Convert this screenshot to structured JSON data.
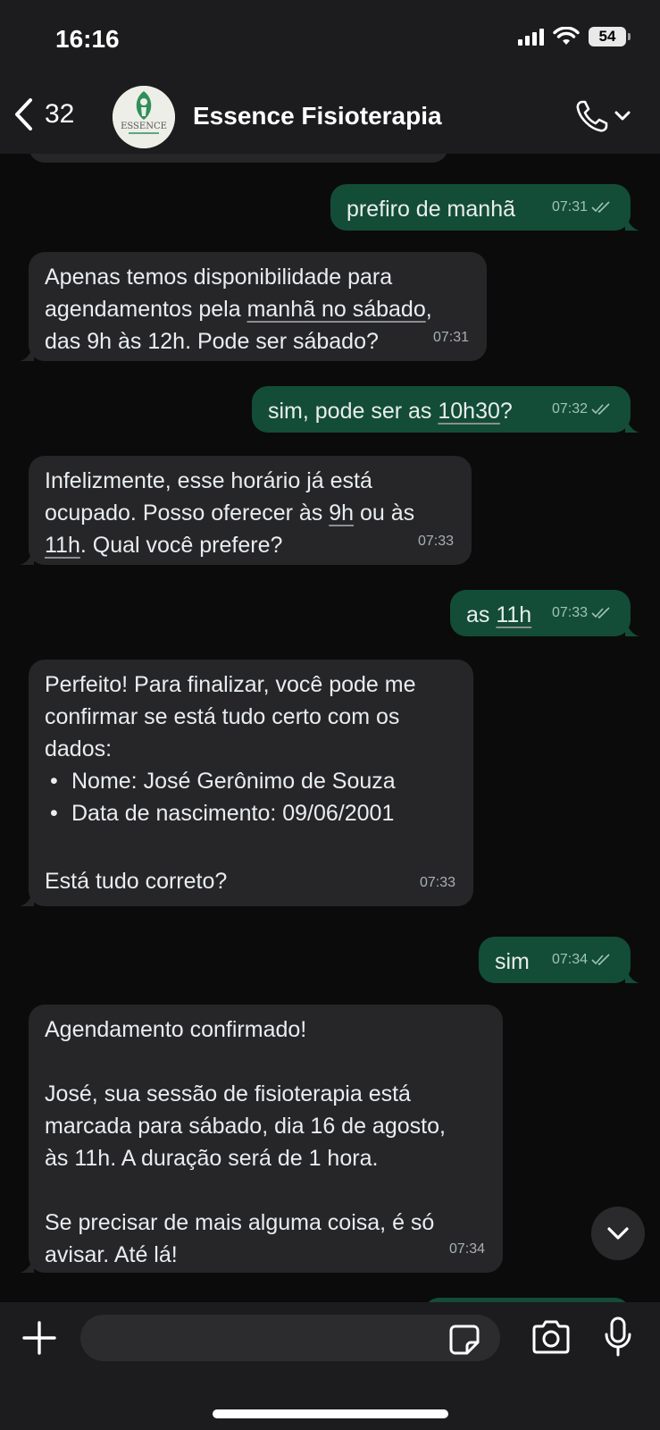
{
  "status_bar": {
    "time": "16:16",
    "battery": "54"
  },
  "header": {
    "back_count": "32",
    "contact_name": "Essence Fisioterapia",
    "avatar_text": "ESSENCE"
  },
  "messages": [
    {
      "dir": "out",
      "text": "prefiro de manhã",
      "time": "07:31"
    },
    {
      "dir": "in",
      "line1": "Apenas temos disponibilidade para",
      "line2a": "agendamentos pela ",
      "line2u": "manhã no sábado",
      "line2b": ",",
      "line3": "das 9h às 12h. Pode ser sábado?",
      "time": "07:31"
    },
    {
      "dir": "out",
      "a": "sim, pode ser as ",
      "u": "10h30",
      "b": "?",
      "time": "07:32"
    },
    {
      "dir": "in",
      "line1": "Infelizmente, esse horário já está",
      "line2a": "ocupado. Posso oferecer às ",
      "line2u": "9h",
      "line2b": " ou às",
      "line3u": "11h",
      "line3b": ". Qual você prefere?",
      "time": "07:33"
    },
    {
      "dir": "out",
      "a": "as ",
      "u": "11h",
      "time": "07:33"
    },
    {
      "dir": "in",
      "line1": "Perfeito! Para finalizar, você pode me",
      "line2": "confirmar se está tudo certo com os",
      "line3": "dados:",
      "bullet1": "Nome: José Gerônimo de Souza",
      "bullet2": "Data de nascimento: 09/06/2001",
      "line4": "Está tudo correto?",
      "time": "07:33"
    },
    {
      "dir": "out",
      "text": "sim",
      "time": "07:34"
    },
    {
      "dir": "in",
      "line1": "Agendamento confirmado!",
      "line2": "José, sua sessão de fisioterapia está",
      "line3": "marcada para sábado, dia 16 de agosto,",
      "line4": "às 11h. A duração será de 1 hora.",
      "line5": "Se precisar de mais alguma coisa, é só",
      "line6": "avisar. Até lá!",
      "time": "07:34"
    }
  ],
  "composer": {
    "placeholder": ""
  },
  "icons": [
    "chevron-left-icon",
    "phone-icon",
    "chevron-down-icon",
    "plus-icon",
    "sticker-icon",
    "camera-icon",
    "microphone-icon",
    "double-check-icon"
  ],
  "colors": {
    "outgoing_bubble": "#134d37",
    "incoming_bubble": "#262628",
    "background": "#0b0b0b"
  }
}
